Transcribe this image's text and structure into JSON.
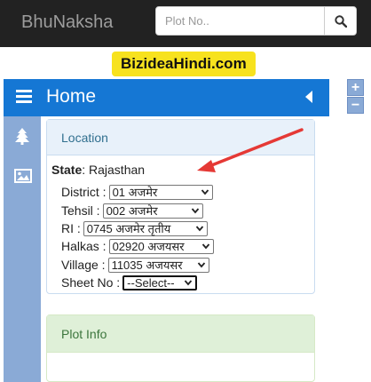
{
  "navbar": {
    "brand": "BhuNaksha",
    "search_placeholder": "Plot No..",
    "search_icon": "search-icon"
  },
  "watermark": "BizideaHindi.com",
  "zoom": {
    "in": "+",
    "out": "−"
  },
  "header": {
    "title": "Home",
    "menu_icon": "hamburger-menu-icon",
    "collapse_icon": "caret-left-icon"
  },
  "sidebar": {
    "icons": [
      "tree-icon",
      "image-icon"
    ]
  },
  "location_panel": {
    "heading": "Location",
    "state_label": "State",
    "state_value": ": Rajasthan",
    "fields": {
      "district": {
        "label": "District :",
        "value": "01 अजमेर"
      },
      "tehsil": {
        "label": "Tehsil :",
        "value": "002 अजमेर"
      },
      "ri": {
        "label": "RI :",
        "value": "0745 अजमेर तृतीय"
      },
      "halkas": {
        "label": "Halkas :",
        "value": "02920 अजयसर"
      },
      "village": {
        "label": "Village :",
        "value": "11035 अजयसर"
      },
      "sheet": {
        "label": "Sheet No :",
        "value": "--Select--"
      }
    }
  },
  "plot_panel": {
    "heading": "Plot Info"
  },
  "colors": {
    "navbar": "#222222",
    "header_blue": "#1577d4",
    "sidebar": "#8aaad6",
    "badge": "#f7e21e",
    "annotation_arrow": "#e53935"
  }
}
